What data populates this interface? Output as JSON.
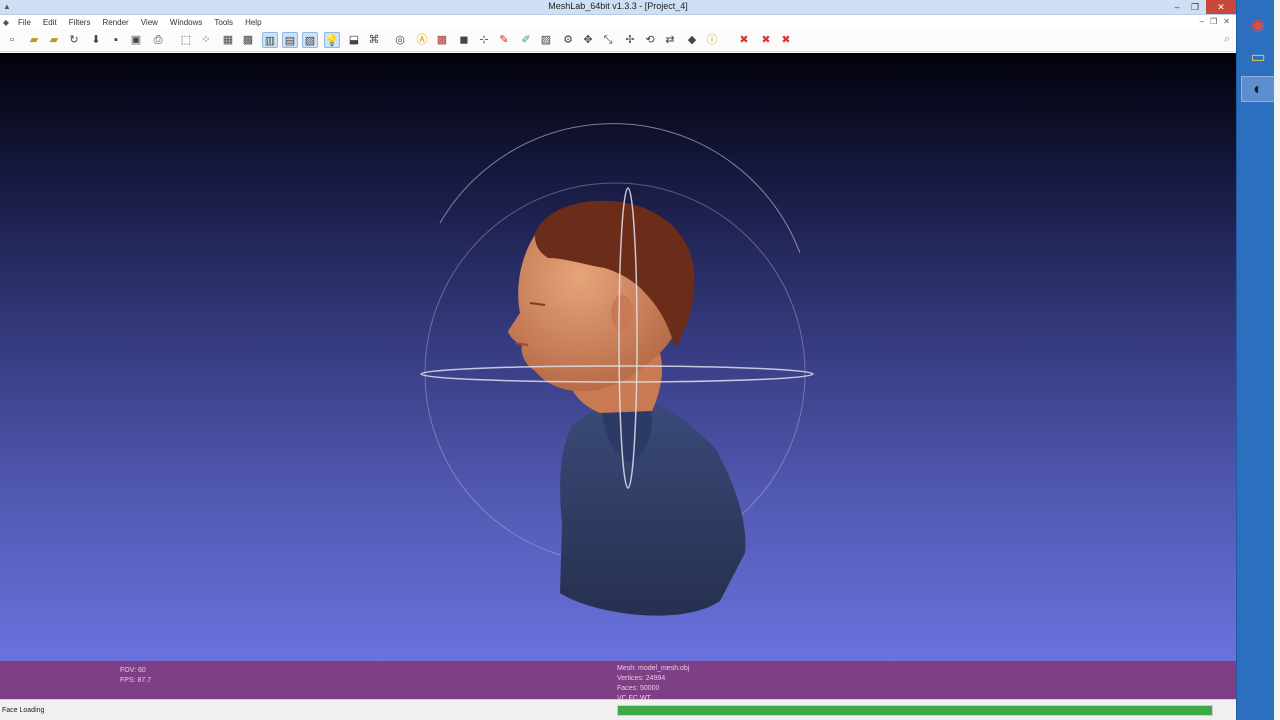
{
  "window": {
    "title": "MeshLab_64bit v1.3.3 - [Project_4]",
    "app_icon": "meshlab-icon",
    "min_glyph": "–",
    "max_glyph": "❐",
    "close_glyph": "✕"
  },
  "menu": {
    "items": [
      "File",
      "Edit",
      "Filters",
      "Render",
      "View",
      "Windows",
      "Tools",
      "Help"
    ],
    "mdi_min": "–",
    "mdi_max": "❐",
    "mdi_close": "✕"
  },
  "toolbar": {
    "icons": [
      "new-project-icon",
      "open-project-icon",
      "open-mesh-icon",
      "reload-icon",
      "import-icon",
      "save-icon",
      "snapshot-icon",
      "print-icon",
      "bounding-box-icon",
      "points-icon",
      "wireframe-icon",
      "hidden-lines-icon",
      "flat-lines-icon",
      "flat-icon",
      "smooth-icon",
      "lighting-icon",
      "backface-icon",
      "select-faces-icon",
      "measure-icon",
      "info-icon",
      "texture-icon",
      "colour-icon",
      "align-icon",
      "paint-icon",
      "pen-icon",
      "layer-icon",
      "filter-icon",
      "manipulator-icon",
      "scale-icon",
      "move-icon",
      "rotate-icon",
      "transform-icon",
      "quality-icon",
      "help-icon",
      "delete-icon",
      "cut-icon",
      "remove-icon"
    ],
    "search_icon": "search-icon"
  },
  "viewport": {
    "colors": {
      "top": "#02020a",
      "bottom": "#6a72de",
      "trackball": "#d8d8e8"
    }
  },
  "info": {
    "left": [
      "FOV: 60",
      "FPS:   87.7"
    ],
    "right": [
      "Mesh: model_mesh.obj",
      "Vertices: 24994",
      "Faces: 50000",
      "VC FC WT"
    ]
  },
  "status": {
    "text": "Face Loading",
    "progress": 1.0
  },
  "taskbar": {
    "items": [
      {
        "name": "chrome",
        "glyph": "◉"
      },
      {
        "name": "file-explorer",
        "glyph": "▭"
      },
      {
        "name": "meshlab",
        "glyph": "◐"
      }
    ]
  }
}
